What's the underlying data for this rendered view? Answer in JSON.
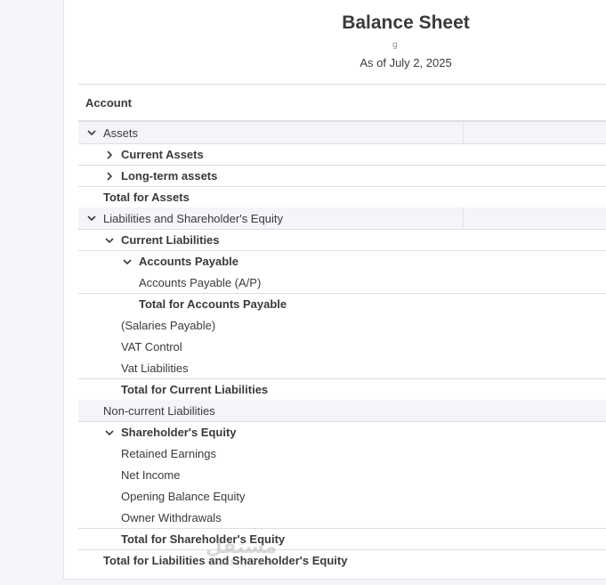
{
  "report": {
    "title": "Balance Sheet",
    "subtitle_fragment": "g",
    "as_of": "As of July 2, 2025",
    "column_header": "Account"
  },
  "rows": {
    "assets": "Assets",
    "current_assets": "Current Assets",
    "long_term_assets": "Long-term assets",
    "total_assets": "Total for Assets",
    "liab_equity": "Liabilities and Shareholder's Equity",
    "current_liabilities": "Current Liabilities",
    "accounts_payable": "Accounts Payable",
    "accounts_payable_ap": "Accounts Payable (A/P)",
    "total_accounts_payable": "Total for Accounts Payable",
    "salaries_payable": "(Salaries Payable)",
    "vat_control": "VAT Control",
    "vat_liabilities": "Vat Liabilities",
    "total_current_liabilities": "Total for Current Liabilities",
    "non_current_liabilities": "Non-current Liabilities",
    "shareholders_equity": "Shareholder's Equity",
    "retained_earnings": "Retained Earnings",
    "net_income": "Net Income",
    "opening_balance_equity": "Opening Balance Equity",
    "owner_withdrawals": "Owner Withdrawals",
    "total_shareholders_equity": "Total for Shareholder's Equity",
    "total_liab_equity": "Total for Liabilities and Shareholder's Equity"
  },
  "icons": {
    "expanded": "chevron-down-icon",
    "collapsed": "chevron-right-icon"
  },
  "watermark": {
    "arabic": "مستقل",
    "latin": "mostaqi.com"
  }
}
